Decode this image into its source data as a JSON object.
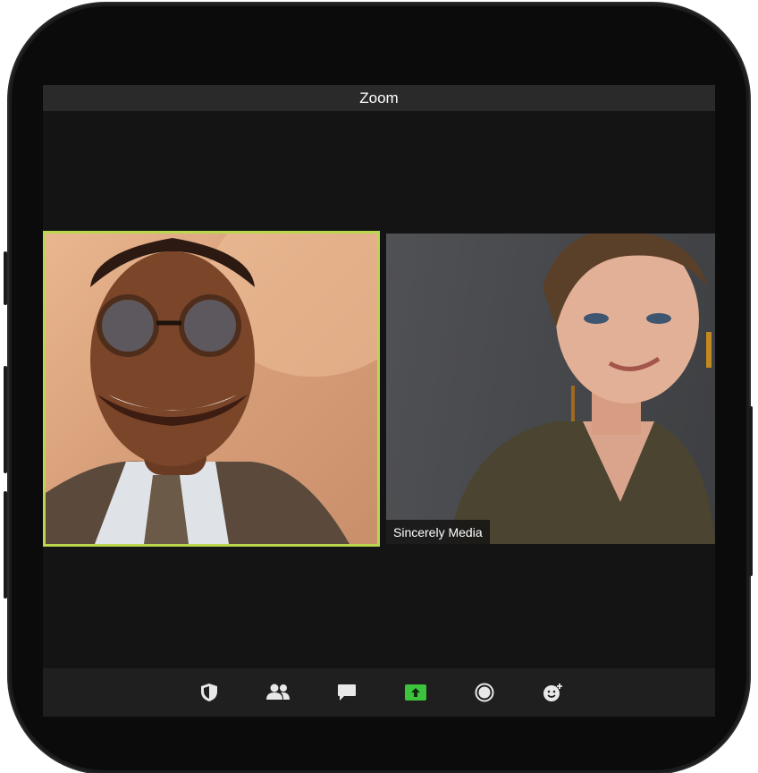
{
  "window": {
    "title": "Zoom"
  },
  "participants": [
    {
      "name": "",
      "active_speaker": true
    },
    {
      "name": "Sincerely Media",
      "active_speaker": false
    }
  ],
  "toolbar": {
    "items": [
      {
        "icon": "security-shield-icon"
      },
      {
        "icon": "participants-icon"
      },
      {
        "icon": "chat-icon"
      },
      {
        "icon": "share-screen-icon",
        "accent": "#3cc43c"
      },
      {
        "icon": "record-icon"
      },
      {
        "icon": "reactions-icon"
      }
    ]
  },
  "colors": {
    "active_speaker_border": "#b9d84f",
    "share_accent": "#3cc43c",
    "background": "#141414"
  }
}
